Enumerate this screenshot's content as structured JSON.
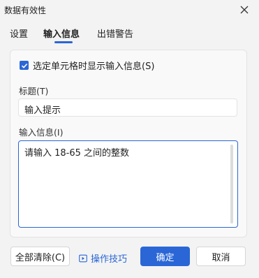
{
  "window": {
    "title": "数据有效性"
  },
  "tabs": [
    {
      "label": "设置"
    },
    {
      "label": "输入信息"
    },
    {
      "label": "出错警告"
    }
  ],
  "active_tab": "输入信息",
  "checkbox": {
    "label": "选定单元格时显示输入信息(S)",
    "checked": true
  },
  "title_field": {
    "label": "标题(T)",
    "value": "输入提示"
  },
  "message_field": {
    "label": "输入信息(I)",
    "value": "请输入 18-65 之间的整数"
  },
  "buttons": {
    "clear_all": "全部清除(C)",
    "tips": "操作技巧",
    "ok": "确定",
    "cancel": "取消"
  },
  "colors": {
    "accent": "#2a66d6",
    "background": "#f3f3f3"
  },
  "icons": [
    "close-icon",
    "checkbox-checked-icon",
    "play-tip-icon"
  ]
}
